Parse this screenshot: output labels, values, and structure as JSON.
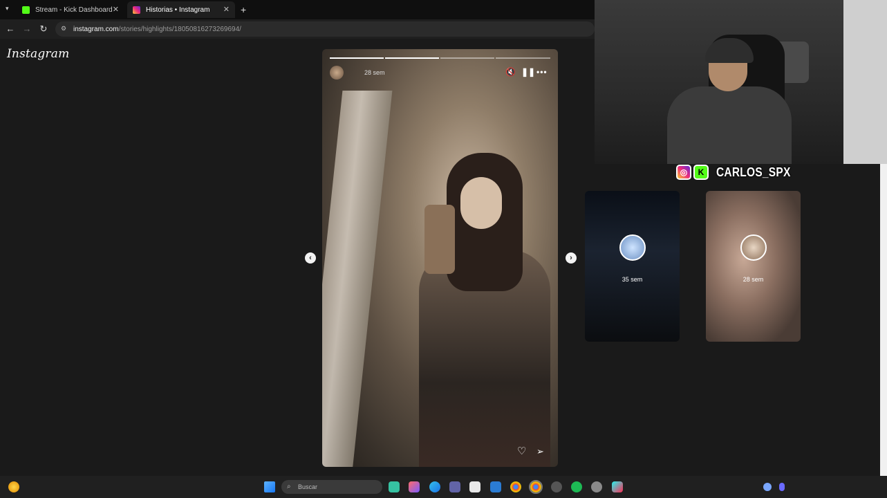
{
  "browser": {
    "tabs": [
      {
        "title": "Stream - Kick Dashboard",
        "favicon": "kick-icon",
        "color": "#53fc18"
      },
      {
        "title": "Historias • Instagram",
        "favicon": "instagram-icon",
        "color": "#e1306c"
      }
    ],
    "url_host": "instagram.com",
    "url_path": "/stories/highlights/18050816273269694/"
  },
  "instagram": {
    "logo": "Instagram",
    "story": {
      "time": "28 sem",
      "progress_segments": [
        1,
        1,
        0,
        0
      ]
    },
    "previews": [
      {
        "time": "35 sem"
      },
      {
        "time": "28 sem"
      }
    ]
  },
  "overlay": {
    "streamer_name": "CARLOS_SPX",
    "instagram_color": "#e1306c",
    "kick_color": "#53fc18"
  },
  "taskbar": {
    "search_placeholder": "Buscar"
  }
}
